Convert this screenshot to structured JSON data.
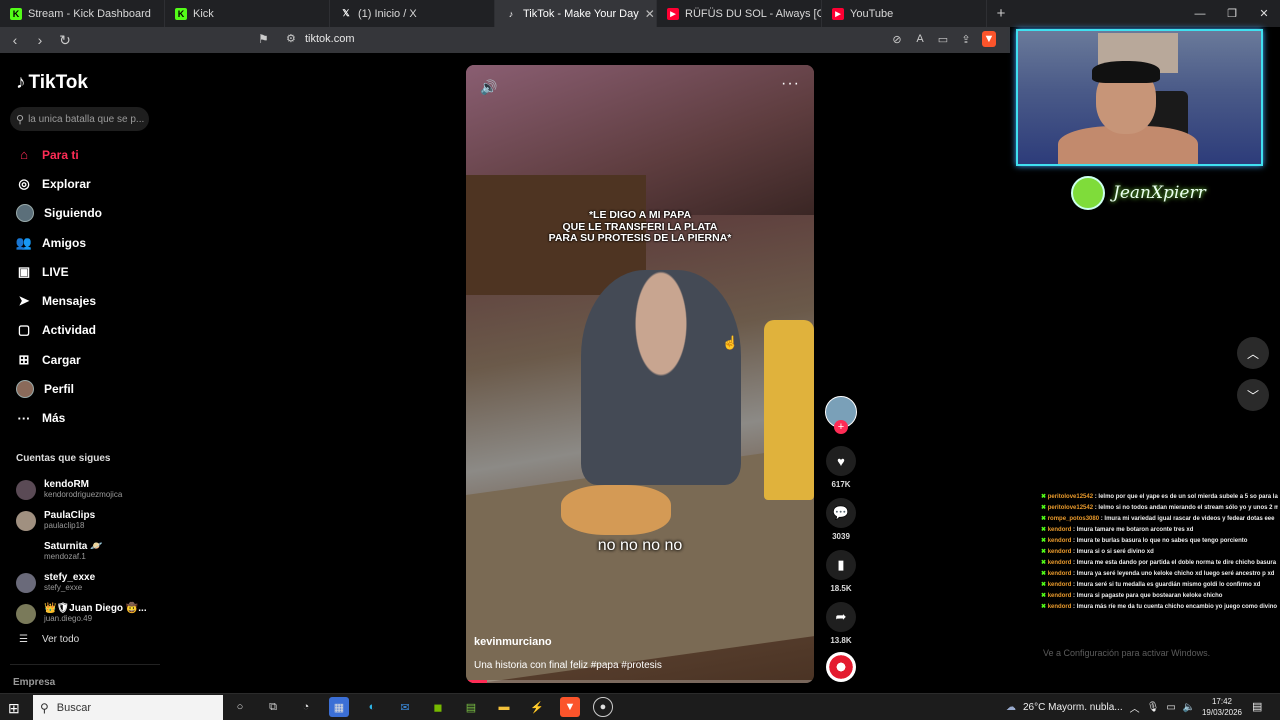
{
  "browser": {
    "tabs": [
      {
        "title": "Stream - Kick Dashboard",
        "icon": "kick-icon",
        "color": "#53fc18",
        "active": false
      },
      {
        "title": "Kick",
        "icon": "kick-icon",
        "color": "#53fc18",
        "active": false
      },
      {
        "title": "(1) Inicio / X",
        "icon": "x-icon",
        "color": "#ffffff",
        "active": false
      },
      {
        "title": "TikTok - Make Your Day",
        "icon": "tiktok-icon",
        "color": "#ffffff",
        "active": true
      },
      {
        "title": "RÜFÜS DU SOL - Always [Official Aud",
        "icon": "youtube-icon",
        "color": "#ff0033",
        "active": false
      },
      {
        "title": "YouTube",
        "icon": "youtube-icon",
        "color": "#ff0033",
        "active": false
      }
    ],
    "url": "tiktok.com"
  },
  "sidebar": {
    "logo": "TikTok",
    "search_placeholder": "la unica batalla que se p...",
    "nav": [
      {
        "label": "Para ti",
        "icon": "home-icon",
        "active": true
      },
      {
        "label": "Explorar",
        "icon": "compass-icon"
      },
      {
        "label": "Siguiendo",
        "icon": "following-avatar-icon"
      },
      {
        "label": "Amigos",
        "icon": "friends-icon"
      },
      {
        "label": "LIVE",
        "icon": "live-icon"
      },
      {
        "label": "Mensajes",
        "icon": "messages-icon"
      },
      {
        "label": "Actividad",
        "icon": "activity-icon"
      },
      {
        "label": "Cargar",
        "icon": "upload-icon"
      },
      {
        "label": "Perfil",
        "icon": "profile-icon"
      },
      {
        "label": "Más",
        "icon": "more-icon"
      }
    ],
    "following_title": "Cuentas que sigues",
    "following": [
      {
        "name": "kendoRM",
        "handle": "kendorodriguezmojica"
      },
      {
        "name": "PaulaClips",
        "handle": "paulaclip18"
      },
      {
        "name": "Saturnita 🪐",
        "handle": "mendozaf.1"
      },
      {
        "name": "stefy_exxe",
        "handle": "stefy_exxe"
      },
      {
        "name": "👑🛡Juan Diego 🤠...",
        "handle": "juan.diego.49"
      }
    ],
    "see_all": "Ver todo",
    "company": "Empresa"
  },
  "video": {
    "overlay_text": "*LE DIGO A MI PAPA\nQUE LE TRANSFERI LA PLATA\nPARA SU PROTESIS DE LA PIERNA*",
    "subtitle": "no no no no",
    "author": "kevinmurciano",
    "description": "Una historia con final feliz #papa #protesis",
    "progress": 0.06
  },
  "actions": {
    "likes": "617K",
    "comments": "3039",
    "saves": "18.5K",
    "shares": "13.8K"
  },
  "stream": {
    "streamer_name": "JeanXpierr",
    "chat": [
      {
        "user": "peritolove12542",
        "text": "lelmo por que el yape es de un sol mierda subele a 5 so para la recarga"
      },
      {
        "user": "peritolove12542",
        "text": "lelmo si no todos andan mierando el stream sólo yo y unos 2 más creo"
      },
      {
        "user": "rompe_potos3080",
        "text": "lmura mi variedad igual rascar de videos y fedear dotas eee"
      },
      {
        "user": "kendord",
        "text": "lmura tamare me botaron arconte tres xd"
      },
      {
        "user": "kendord",
        "text": "lmura te burlas basura lo que no sabes que tengo porciento"
      },
      {
        "user": "kendord",
        "text": "lmura si o si seré divino xd"
      },
      {
        "user": "kendord",
        "text": "lmura me esta dando por partida el doble norma te dire chicho basura xd"
      },
      {
        "user": "kendord",
        "text": "lmura ya seré leyenda uno keloke chicho xd luego seré ancestro p xd"
      },
      {
        "user": "kendord",
        "text": "lmura seré si tu medalla es guardián mismo goldi lo confirmo xd"
      },
      {
        "user": "kendord",
        "text": "lmura si pagaste para que bostearan keloke chicho"
      },
      {
        "user": "kendord",
        "text": "lmura más ríe me da tu cuenta chicho encambio yo juego como divino xd"
      }
    ],
    "activate_windows": "Ve a Configuración para activar Windows."
  },
  "taskbar": {
    "search_label": "Buscar",
    "weather": "26°C  Mayorm. nubla...",
    "time": "17:42",
    "date": "19/03/2026"
  },
  "colors": {
    "accent": "#fe2c55",
    "kick_green": "#53fc18",
    "cam_border": "#40e0f0"
  }
}
